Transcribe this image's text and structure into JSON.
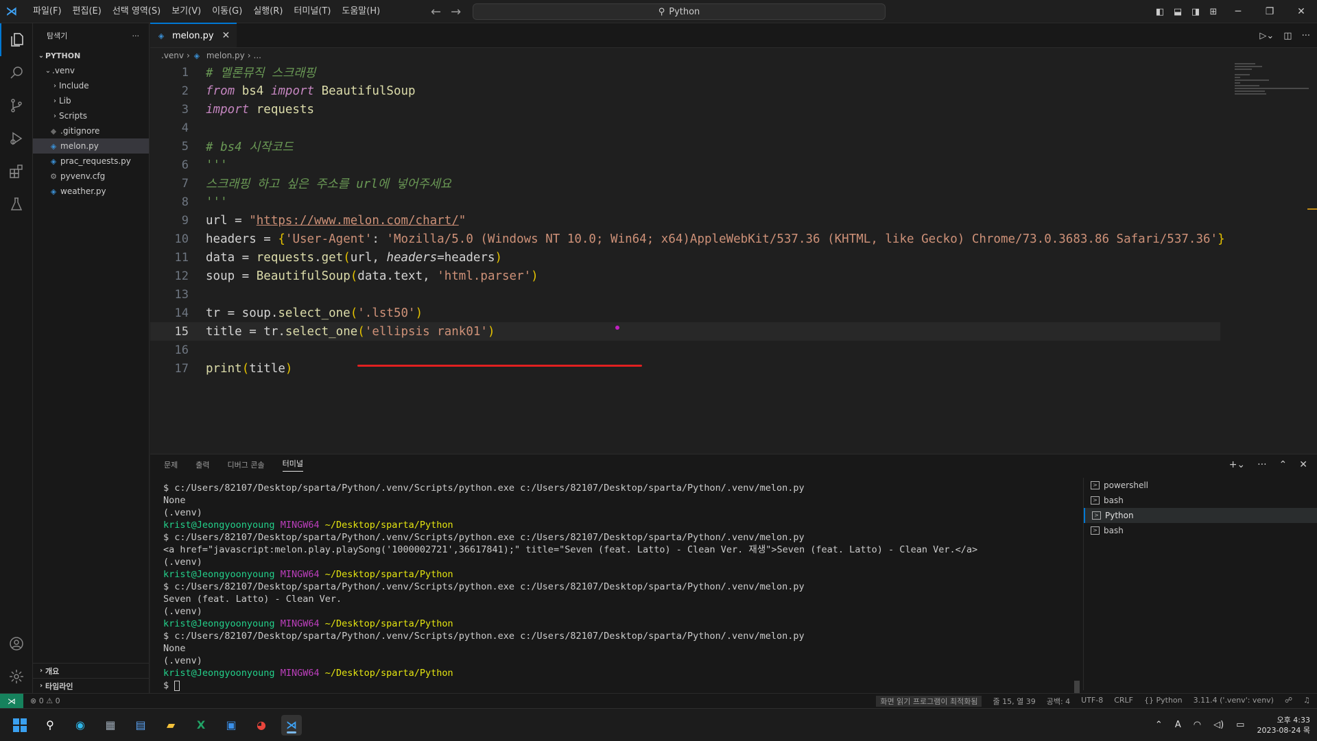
{
  "titlebar": {
    "menu": [
      "파일(F)",
      "편집(E)",
      "선택 영역(S)",
      "보기(V)",
      "이동(G)",
      "실행(R)",
      "터미널(T)",
      "도움말(H)"
    ],
    "search": "Python"
  },
  "sidebar": {
    "header": "탐색기",
    "folder": "PYTHON",
    "items": [
      {
        "label": ".venv"
      },
      {
        "label": "Include"
      },
      {
        "label": "Lib"
      },
      {
        "label": "Scripts"
      },
      {
        "label": ".gitignore"
      },
      {
        "label": "melon.py"
      },
      {
        "label": "prac_requests.py"
      },
      {
        "label": "pyvenv.cfg"
      },
      {
        "label": "weather.py"
      }
    ],
    "outline": "개요",
    "timeline": "타임라인"
  },
  "editor": {
    "tab": "melon.py",
    "breadcrumb": [
      ".venv",
      "melon.py",
      "..."
    ],
    "lines": {
      "l1": "# 멜론뮤직 스크래핑",
      "l2_from": "from",
      "l2_mod": " bs4 ",
      "l2_imp": "import",
      "l2_cls": " BeautifulSoup",
      "l3_imp": "import",
      "l3_mod": " requests",
      "l5": "# bs4 시작코드",
      "l6": "'''",
      "l7": "스크래핑 하고 싶은 주소를 url에 넣어주세요",
      "l8": "'''",
      "l9_a": "url = ",
      "l9_q": "\"",
      "l9_url": "https://www.melon.com/chart/",
      "l9_q2": "\"",
      "l10_a": "headers = ",
      "l10_b": "{",
      "l10_c": "'User-Agent'",
      "l10_d": ": ",
      "l10_e": "'Mozilla/5.0 (Windows NT 10.0; Win64; x64)AppleWebKit/537.36 (KHTML, like Gecko) Chrome/73.0.3683.86 Safari/537.36'",
      "l10_f": "}",
      "l11_a": "data = ",
      "l11_b": "requests",
      "l11_c": ".",
      "l11_d": "get",
      "l11_e": "(",
      "l11_f": "url, ",
      "l11_g": "headers",
      "l11_h": "=headers",
      "l11_i": ")",
      "l12_a": "soup = ",
      "l12_b": "BeautifulSoup",
      "l12_c": "(",
      "l12_d": "data.text, ",
      "l12_e": "'html.parser'",
      "l12_f": ")",
      "l14_a": "tr = soup.",
      "l14_b": "select_one",
      "l14_c": "(",
      "l14_d": "'.lst50'",
      "l14_e": ")",
      "l15_a": "title = tr.",
      "l15_b": "select_one",
      "l15_c": "(",
      "l15_d": "'ellipsis rank01'",
      "l15_e": ")",
      "l17_a": "print",
      "l17_b": "(",
      "l17_c": "title",
      "l17_d": ")"
    }
  },
  "panel": {
    "tabs": [
      "문제",
      "출력",
      "디버그 콘솔",
      "터미널"
    ],
    "terminal": {
      "cmd": "$ c:/Users/82107/Desktop/sparta/Python/.venv/Scripts/python.exe c:/Users/82107/Desktop/sparta/Python/.venv/melon.py",
      "none": "None",
      "venv": "(.venv)",
      "user": "krist@Jeongyoonyoung",
      "mingw": "MINGW64",
      "path": "~/Desktop/sparta/Python",
      "out_a": "<a href=\"javascript:melon.play.playSong('1000002721',36617841);\" title=\"Seven (feat. Latto) - Clean Ver. 재생\">Seven (feat. Latto) - Clean Ver.</a>",
      "out_b": "Seven (feat. Latto) - Clean Ver.",
      "prompt": "$ "
    },
    "terminals": [
      "powershell",
      "bash",
      "Python",
      "bash"
    ]
  },
  "status": {
    "errors": "⊗ 0 ⚠ 0",
    "reader": "화면 읽기 프로그램이 최적화됨",
    "position": "줄 15, 열 39",
    "spaces": "공백: 4",
    "encoding": "UTF-8",
    "eol": "CRLF",
    "lang": "{} Python",
    "interpreter": "3.11.4 ('.venv': venv)"
  },
  "taskbar": {
    "ampm": "오후 4:33",
    "date": "2023-08-24 목"
  }
}
